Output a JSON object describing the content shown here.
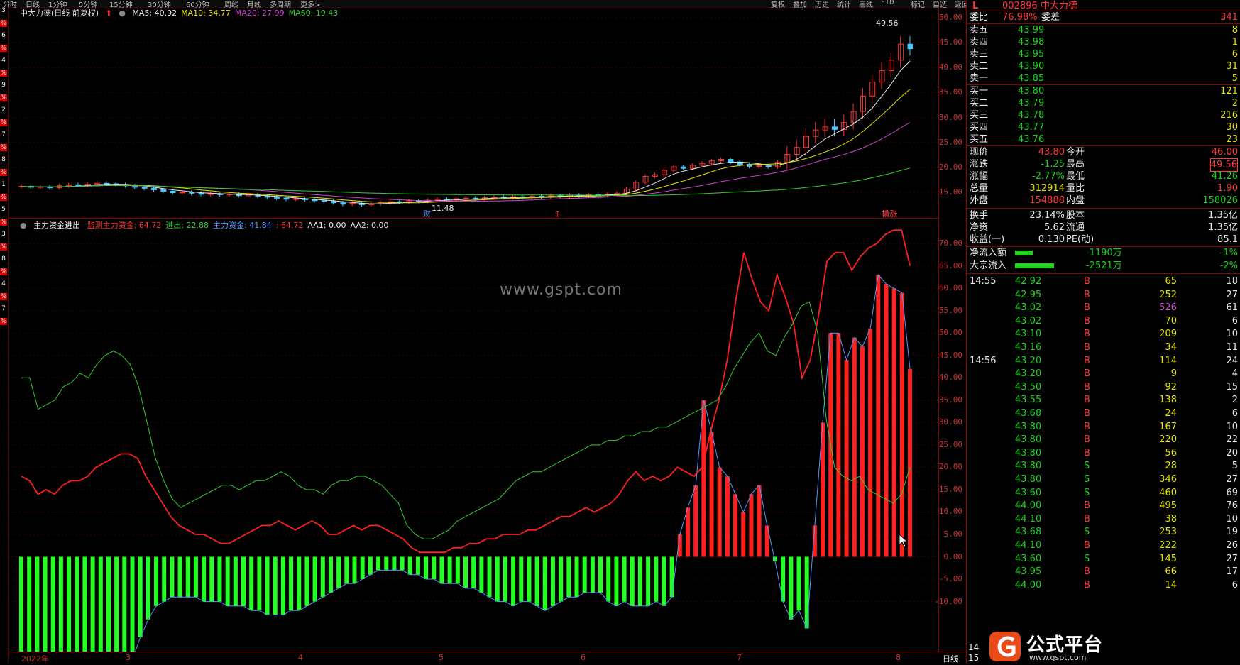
{
  "toolbar": {
    "left_items": [
      "分时",
      "日线",
      "1分钟",
      "5分钟",
      "15分钟",
      "30分钟",
      "60分钟",
      "周线",
      "月线",
      "多周期",
      "更多>"
    ],
    "right_items": [
      "复权",
      "叠加",
      "历史",
      "统计",
      "画线",
      "F10",
      "标记",
      "自选",
      "返回"
    ]
  },
  "left_edge_digits": [
    "3",
    "%",
    "6",
    "%",
    "4",
    "%",
    "9",
    "%",
    "2",
    "%",
    "7",
    "%",
    "8",
    "%",
    "1",
    "%",
    "5",
    "%",
    "3",
    "%",
    "8",
    "%",
    "4",
    "%",
    "7",
    "%"
  ],
  "upper_panel": {
    "title": "中大力德(日线 前复权)",
    "ma": [
      {
        "label": "MA5: 40.92",
        "color": "#e8e8e8"
      },
      {
        "label": "MA10: 34.77",
        "color": "#e6e600"
      },
      {
        "label": "MA20: 27.99",
        "color": "#cc44cc"
      },
      {
        "label": "MA60: 19.43",
        "color": "#33cc33"
      }
    ],
    "high_label": "49.56",
    "low_label": "11.48",
    "markers": [
      {
        "label": "财",
        "color": "#6699ff"
      },
      {
        "label": "$",
        "color": "#ff4444"
      },
      {
        "label": "横涨",
        "color": "#ff4444"
      }
    ],
    "y_ticks": [
      "50.00",
      "45.00",
      "40.00",
      "35.00",
      "30.00",
      "25.00",
      "20.00",
      "15.00"
    ]
  },
  "lower_panel": {
    "title": "主力资金进出",
    "legend": [
      {
        "label": "监测主力资金: 64.72",
        "color": "#ff3333"
      },
      {
        "label": "进出: 22.88",
        "color": "#33cc33"
      },
      {
        "label": "主力资金: 41.84",
        "color": "#5599ff"
      },
      {
        "label": ": 64.72",
        "color": "#ff3333"
      },
      {
        "label": "AA1: 0.00",
        "color": "#e8e8e8"
      },
      {
        "label": "AA2: 0.00",
        "color": "#e8e8e8"
      }
    ],
    "watermark": "www.gspt.com",
    "y_ticks": [
      "70.00",
      "65.00",
      "60.00",
      "55.00",
      "50.00",
      "45.00",
      "40.00",
      "35.00",
      "30.00",
      "25.00",
      "20.00",
      "15.00",
      "10.00",
      "5.00",
      "0.00",
      "-5.00",
      "-10.00"
    ]
  },
  "bottom_axis": {
    "labels": [
      "2022年",
      "3",
      "4",
      "5",
      "6",
      "7",
      "8"
    ],
    "period": "日线"
  },
  "right_panel": {
    "header": {
      "code": "002896",
      "name": "中大力德",
      "flag": "L"
    },
    "weibi": {
      "label": "委比",
      "value": "76.98%",
      "label2": "委差",
      "value2": "341"
    },
    "asks": [
      {
        "label": "卖五",
        "price": "43.99",
        "vol": "8"
      },
      {
        "label": "卖四",
        "price": "43.98",
        "vol": "1"
      },
      {
        "label": "卖三",
        "price": "43.95",
        "vol": "6"
      },
      {
        "label": "卖二",
        "price": "43.90",
        "vol": "31"
      },
      {
        "label": "卖一",
        "price": "43.85",
        "vol": "5"
      }
    ],
    "bids": [
      {
        "label": "买一",
        "price": "43.80",
        "vol": "121"
      },
      {
        "label": "买二",
        "price": "43.79",
        "vol": "2"
      },
      {
        "label": "买三",
        "price": "43.78",
        "vol": "216"
      },
      {
        "label": "买四",
        "price": "43.77",
        "vol": "30"
      },
      {
        "label": "买五",
        "price": "43.76",
        "vol": "23"
      }
    ],
    "quote": [
      {
        "l1": "现价",
        "v1": "43.80",
        "c1": "red",
        "l2": "今开",
        "v2": "46.00",
        "c2": "red"
      },
      {
        "l1": "涨跌",
        "v1": "-1.25",
        "c1": "green",
        "l2": "最高",
        "v2": "49.56",
        "c2": "red"
      },
      {
        "l1": "涨幅",
        "v1": "-2.77%",
        "c1": "green",
        "l2": "最低",
        "v2": "41.26",
        "c2": "green"
      },
      {
        "l1": "总量",
        "v1": "312914",
        "c1": "yellow",
        "l2": "量比",
        "v2": "1.90",
        "c2": "red"
      },
      {
        "l1": "外盘",
        "v1": "154888",
        "c1": "red",
        "l2": "内盘",
        "v2": "158026",
        "c2": "green"
      }
    ],
    "stats": [
      {
        "l1": "换手",
        "v1": "23.14%",
        "l2": "股本",
        "v2": "1.35亿"
      },
      {
        "l1": "净资",
        "v1": "5.62",
        "l2": "流通",
        "v2": "1.35亿"
      },
      {
        "l1": "收益(一)",
        "v1": "0.130",
        "l2": "PE(动)",
        "v2": "85.1"
      }
    ],
    "flows": [
      {
        "label": "净流入额",
        "value": "-1190万",
        "pct": "-1%",
        "bar": 0.25
      },
      {
        "label": "大宗流入",
        "value": "-2521万",
        "pct": "-2%",
        "bar": 0.55
      }
    ],
    "ticks": [
      {
        "time": "14:55",
        "price": "42.92",
        "pc": "green",
        "vol": "65",
        "vc": "yellow",
        "bs": "B",
        "n": "18"
      },
      {
        "time": "",
        "price": "42.95",
        "pc": "green",
        "vol": "252",
        "vc": "yellow",
        "bs": "B",
        "n": "27"
      },
      {
        "time": "",
        "price": "43.02",
        "pc": "green",
        "vol": "526",
        "vc": "purple",
        "bs": "B",
        "n": "61"
      },
      {
        "time": "",
        "price": "43.02",
        "pc": "green",
        "vol": "70",
        "vc": "yellow",
        "bs": "B",
        "n": "6"
      },
      {
        "time": "",
        "price": "43.10",
        "pc": "green",
        "vol": "209",
        "vc": "yellow",
        "bs": "B",
        "n": "10"
      },
      {
        "time": "",
        "price": "43.16",
        "pc": "green",
        "vol": "34",
        "vc": "yellow",
        "bs": "B",
        "n": "11"
      },
      {
        "time": "14:56",
        "price": "43.20",
        "pc": "green",
        "vol": "114",
        "vc": "yellow",
        "bs": "B",
        "n": "24"
      },
      {
        "time": "",
        "price": "43.20",
        "pc": "green",
        "vol": "9",
        "vc": "yellow",
        "bs": "B",
        "n": "4"
      },
      {
        "time": "",
        "price": "43.50",
        "pc": "green",
        "vol": "92",
        "vc": "yellow",
        "bs": "B",
        "n": "15"
      },
      {
        "time": "",
        "price": "43.55",
        "pc": "green",
        "vol": "138",
        "vc": "yellow",
        "bs": "B",
        "n": "2"
      },
      {
        "time": "",
        "price": "43.68",
        "pc": "green",
        "vol": "24",
        "vc": "yellow",
        "bs": "B",
        "n": "6"
      },
      {
        "time": "",
        "price": "43.80",
        "pc": "green",
        "vol": "167",
        "vc": "yellow",
        "bs": "B",
        "n": "10"
      },
      {
        "time": "",
        "price": "43.80",
        "pc": "green",
        "vol": "220",
        "vc": "yellow",
        "bs": "B",
        "n": "22"
      },
      {
        "time": "",
        "price": "43.80",
        "pc": "green",
        "vol": "56",
        "vc": "yellow",
        "bs": "B",
        "n": "20"
      },
      {
        "time": "",
        "price": "43.80",
        "pc": "green",
        "vol": "28",
        "vc": "yellow",
        "bs": "S",
        "n": "5"
      },
      {
        "time": "",
        "price": "43.80",
        "pc": "green",
        "vol": "346",
        "vc": "yellow",
        "bs": "S",
        "n": "27"
      },
      {
        "time": "",
        "price": "43.60",
        "pc": "green",
        "vol": "460",
        "vc": "yellow",
        "bs": "S",
        "n": "69"
      },
      {
        "time": "",
        "price": "44.00",
        "pc": "green",
        "vol": "495",
        "vc": "yellow",
        "bs": "B",
        "n": "76"
      },
      {
        "time": "",
        "price": "44.10",
        "pc": "green",
        "vol": "38",
        "vc": "yellow",
        "bs": "B",
        "n": "10"
      },
      {
        "time": "",
        "price": "43.68",
        "pc": "green",
        "vol": "253",
        "vc": "yellow",
        "bs": "S",
        "n": "19"
      },
      {
        "time": "",
        "price": "44.10",
        "pc": "green",
        "vol": "222",
        "vc": "yellow",
        "bs": "B",
        "n": "26"
      },
      {
        "time": "",
        "price": "43.60",
        "pc": "green",
        "vol": "145",
        "vc": "yellow",
        "bs": "S",
        "n": "27"
      },
      {
        "time": "",
        "price": "43.95",
        "pc": "green",
        "vol": "66",
        "vc": "yellow",
        "bs": "B",
        "n": "17"
      },
      {
        "time": "",
        "price": "44.00",
        "pc": "green",
        "vol": "14",
        "vc": "yellow",
        "bs": "B",
        "n": "6"
      }
    ],
    "bottom_digits": [
      "14",
      "15"
    ]
  },
  "logo": {
    "text": "公式平台",
    "sub": "www.gspt.com"
  },
  "chart_data": [
    {
      "type": "candlestick",
      "title": "中大力德(日线 前复权)",
      "ylim": [
        11,
        51
      ],
      "x_labels": [
        "2022年",
        "3",
        "4",
        "5",
        "6",
        "7",
        "8"
      ],
      "close_series": [
        16.2,
        16.0,
        16.1,
        15.9,
        16.3,
        16.5,
        16.4,
        16.6,
        16.8,
        16.7,
        16.5,
        16.3,
        16.0,
        15.8,
        15.5,
        15.2,
        14.9,
        15.0,
        14.8,
        14.6,
        14.7,
        14.5,
        14.6,
        14.3,
        14.5,
        14.2,
        14.0,
        13.8,
        13.6,
        13.7,
        13.5,
        13.3,
        13.2,
        12.9,
        12.6,
        12.8,
        12.5,
        12.7,
        12.9,
        13.1,
        13.0,
        13.3,
        13.2,
        13.4,
        13.6,
        13.5,
        13.7,
        13.8,
        13.6,
        13.9,
        14.0,
        13.9,
        14.1,
        14.0,
        14.2,
        14.1,
        14.3,
        14.2,
        14.4,
        14.3,
        14.5,
        14.4,
        14.6,
        14.8,
        15.6,
        17.0,
        18.2,
        18.5,
        19.4,
        20.1,
        19.8,
        20.4,
        20.8,
        21.3,
        21.6,
        21.0,
        20.6,
        20.2,
        20.3,
        20.1,
        21.0,
        22.6,
        24.0,
        26.2,
        27.5,
        28.1,
        27.6,
        29.0,
        31.2,
        34.3,
        37.1,
        39.4,
        41.5,
        44.7,
        43.8
      ],
      "ma5_last": 40.92,
      "ma10_last": 34.77,
      "ma20_last": 27.99,
      "ma60_last": 19.43,
      "high": 49.56,
      "low": 11.48
    },
    {
      "type": "bar+line",
      "title": "主力资金进出",
      "ylim": [
        -18,
        74
      ],
      "series": [
        {
          "name": "监测主力资金",
          "values": [
            18,
            17,
            14,
            15,
            14,
            16,
            17,
            17,
            18,
            20,
            21,
            22,
            23,
            23,
            22,
            18,
            15,
            12,
            9,
            7,
            6,
            5,
            5,
            4,
            3,
            3,
            4,
            5,
            6,
            7,
            7,
            8,
            7,
            6,
            7,
            8,
            7,
            5,
            5,
            6,
            7,
            6,
            7,
            7,
            6,
            5,
            4,
            2,
            1,
            1,
            1,
            1,
            2,
            2,
            3,
            3,
            4,
            4,
            5,
            5,
            5,
            6,
            6,
            7,
            8,
            9,
            9,
            10,
            11,
            10,
            11,
            12,
            14,
            17,
            19,
            17,
            18,
            17,
            18,
            20,
            19,
            18,
            20,
            28,
            35,
            44,
            57,
            68,
            62,
            57,
            55,
            63,
            58,
            52,
            40,
            44,
            54,
            66,
            68,
            68,
            64,
            67,
            69,
            70,
            72,
            73,
            73,
            65
          ]
        },
        {
          "name": "进出",
          "values": [
            40,
            40,
            33,
            34,
            35,
            38,
            39,
            41,
            40,
            43,
            45,
            46,
            45,
            43,
            38,
            30,
            22,
            17,
            13,
            11,
            12,
            13,
            14,
            15,
            16,
            16,
            15,
            16,
            17,
            17,
            18,
            19,
            18,
            16,
            15,
            15,
            14,
            16,
            17,
            17,
            18,
            18,
            17,
            16,
            14,
            12,
            7,
            5,
            4,
            4,
            5,
            6,
            8,
            9,
            10,
            11,
            12,
            13,
            15,
            17,
            18,
            19,
            19,
            20,
            21,
            22,
            23,
            24,
            25,
            25,
            26,
            26,
            27,
            27,
            28,
            28,
            29,
            29,
            30,
            31,
            32,
            33,
            34,
            35,
            38,
            42,
            45,
            48,
            50,
            46,
            45,
            49,
            52,
            56,
            57,
            50,
            31,
            20,
            18,
            17,
            18,
            15,
            14,
            13,
            12,
            14,
            20
          ]
        },
        {
          "name": "主力资金",
          "values": [
            -23,
            -25,
            -25,
            -24,
            -24,
            -23,
            -23,
            -23,
            -23,
            -24,
            -24,
            -24,
            -24,
            -24,
            -23,
            -18,
            -14,
            -11,
            -10,
            -9,
            -9,
            -9,
            -9,
            -10,
            -10,
            -10,
            -11,
            -11,
            -11,
            -12,
            -12,
            -13,
            -13,
            -13,
            -12,
            -12,
            -11,
            -10,
            -9,
            -8,
            -7,
            -6,
            -6,
            -5,
            -4,
            -3,
            -3,
            -3,
            -3,
            -4,
            -4,
            -5,
            -5,
            -6,
            -6,
            -6,
            -7,
            -7,
            -8,
            -9,
            -10,
            -10,
            -11,
            -10,
            -10,
            -11,
            -12,
            -11,
            -10,
            -9,
            -9,
            -8,
            -8,
            -8,
            -10,
            -11,
            -10,
            -11,
            -11,
            -11,
            -10,
            -11,
            -9,
            5,
            11,
            16,
            35,
            28,
            20,
            18,
            14,
            10,
            14,
            16,
            7,
            -1,
            -10,
            -14,
            -12,
            -16,
            7,
            30,
            50,
            50,
            44,
            49,
            47,
            51,
            63,
            61,
            60,
            59,
            42
          ]
        }
      ]
    }
  ]
}
